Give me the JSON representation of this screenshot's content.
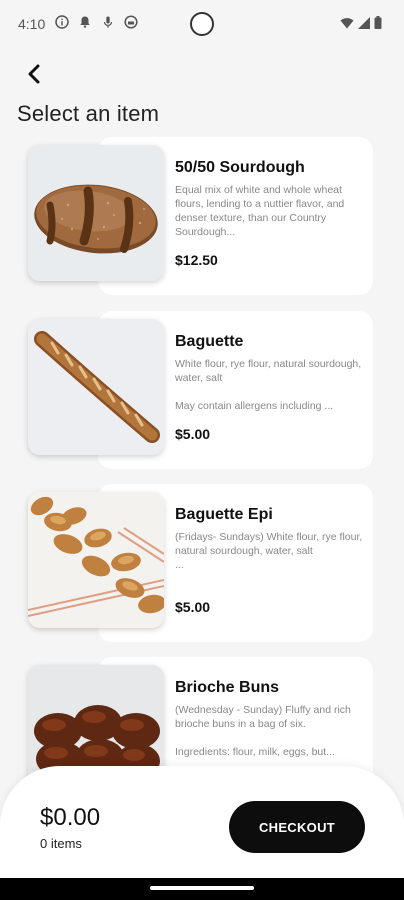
{
  "status_bar": {
    "time": "4:10",
    "left_icons": [
      "info-icon",
      "notification-bell-icon",
      "mic-icon",
      "vpn-icon"
    ],
    "right_icons": [
      "wifi-icon",
      "signal-icon",
      "battery-icon"
    ]
  },
  "header": {
    "back_icon": "chevron-left-icon",
    "title": "Select an item"
  },
  "items": [
    {
      "name": "50/50 Sourdough",
      "description": "Equal mix of white and whole wheat flours, lending to a nuttier flavor, and denser texture, than our Country Sourdough...",
      "price": "$12.50",
      "image": "sourdough-loaf"
    },
    {
      "name": "Baguette",
      "description": "White flour, rye flour, natural sourdough, water, salt\n\nMay contain allergens including ...",
      "price": "$5.00",
      "image": "baguette"
    },
    {
      "name": "Baguette Epi",
      "description": "(Fridays- Sundays) White flour, rye flour, natural sourdough, water, salt\n...",
      "price": "$5.00",
      "image": "baguette-epi"
    },
    {
      "name": "Brioche Buns",
      "description": "(Wednesday - Sunday) Fluffy and rich brioche buns in a bag of six.\n\nIngredients: flour, milk, eggs, but...",
      "price": "",
      "image": "brioche-buns"
    }
  ],
  "cart": {
    "total": "$0.00",
    "count": "0 items",
    "checkout_label": "CHECKOUT"
  }
}
